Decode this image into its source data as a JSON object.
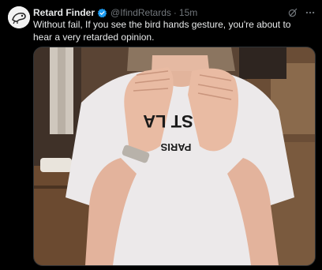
{
  "tweet": {
    "author_name": "Retard Finder",
    "handle": "@IfindRetards",
    "separator": "·",
    "time": "15m",
    "text": "Without fail, If you see the bird hands gesture, you're about to hear a very retarded opinion.",
    "media": {
      "shirt_text_line1": "ST LA",
      "shirt_text_line2": "PARIS"
    }
  },
  "icons": {
    "verified": "verified-badge-icon",
    "grok": "grok-icon",
    "more": "more-options-icon"
  },
  "colors": {
    "background": "#000000",
    "text": "#e7e9ea",
    "secondary": "#71767b",
    "verified": "#1d9bf0"
  }
}
